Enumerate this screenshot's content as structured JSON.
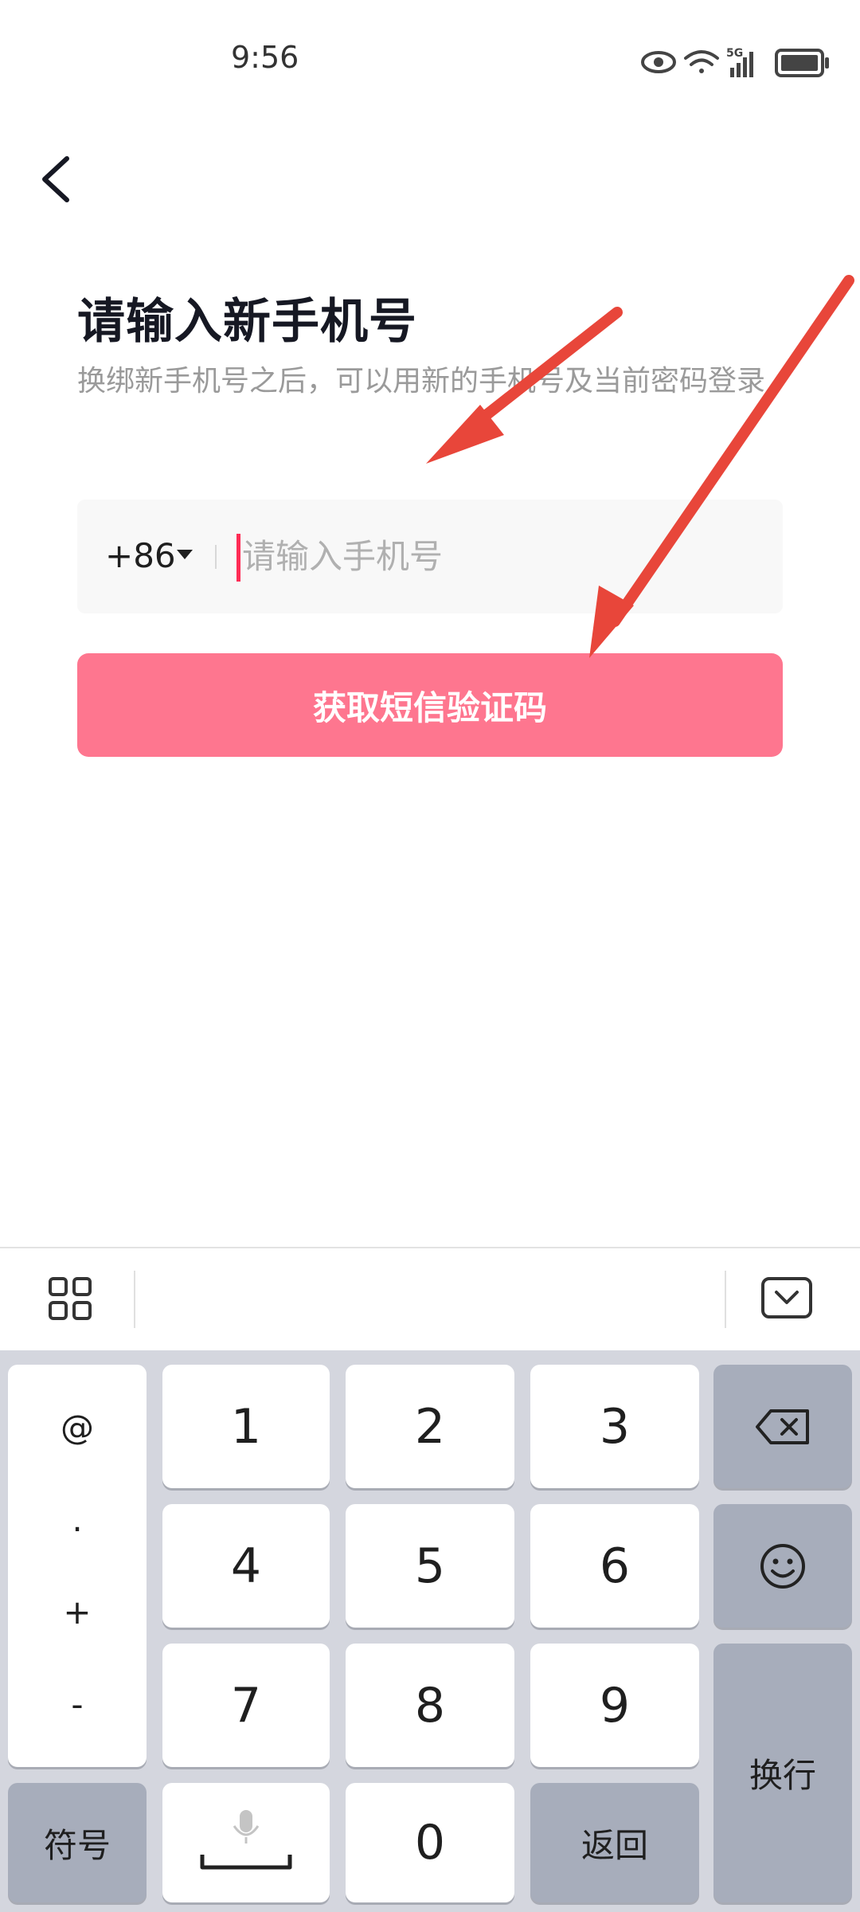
{
  "status_bar": {
    "time": "9:56",
    "network": "5G",
    "icons": [
      "eye-icon",
      "wifi-icon",
      "signal-icon",
      "battery-icon"
    ]
  },
  "header": {
    "title": "请输入新手机号",
    "subtitle": "换绑新手机号之后，可以用新的手机号及当前密码登录"
  },
  "phone_form": {
    "country_code": "+86",
    "placeholder": "请输入手机号",
    "value": ""
  },
  "sms_button": {
    "label": "获取短信验证码"
  },
  "colors": {
    "accent": "#fe2c55",
    "button": "#fe768f",
    "annotation_arrow": "#e8463a",
    "keyboard_bg": "#d4d6de",
    "function_key": "#a7adbb"
  },
  "keyboard": {
    "symbol_keys": [
      "@",
      ".",
      "+",
      "-"
    ],
    "digits": [
      "1",
      "2",
      "3",
      "4",
      "5",
      "6",
      "7",
      "8",
      "9"
    ],
    "zero": "0",
    "symbols_label": "符号",
    "back_label": "返回",
    "newline_label": "换行"
  }
}
